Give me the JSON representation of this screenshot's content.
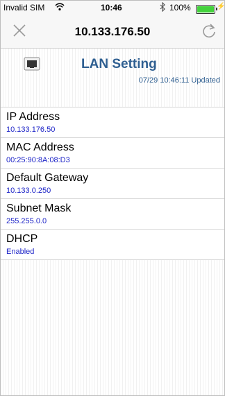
{
  "status_bar": {
    "carrier": "Invalid SIM",
    "time": "10:46",
    "battery": "100%"
  },
  "nav": {
    "title": "10.133.176.50",
    "close_icon": "close-icon",
    "refresh_icon": "refresh-icon"
  },
  "header": {
    "title": "LAN Setting",
    "updated": "07/29 10:46:11 Updated",
    "icon": "ethernet-port-icon"
  },
  "rows": [
    {
      "label": "IP Address",
      "value": "10.133.176.50"
    },
    {
      "label": "MAC Address",
      "value": "00:25:90:8A:08:D3"
    },
    {
      "label": "Default Gateway",
      "value": "10.133.0.250"
    },
    {
      "label": "Subnet Mask",
      "value": "255.255.0.0"
    },
    {
      "label": "DHCP",
      "value": "Enabled"
    }
  ],
  "colors": {
    "title_blue": "#2f5f91",
    "value_blue": "#1c23c7",
    "battery_green": "#43d23c"
  }
}
